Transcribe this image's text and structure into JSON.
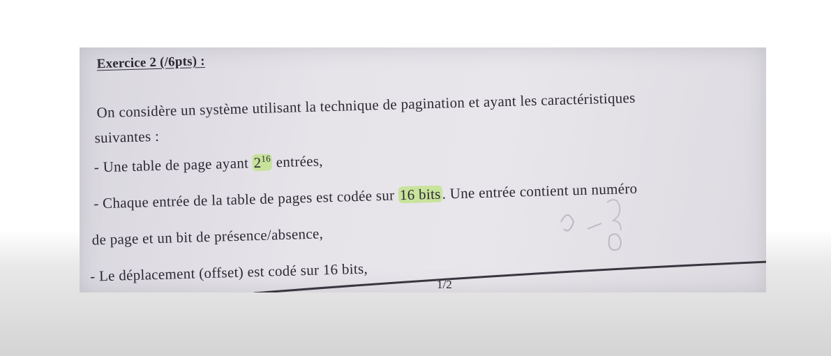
{
  "exercise": {
    "title": "Exercice 2 (/6pts) :",
    "intro_line1": "On considère un système utilisant la technique de pagination et ayant les caractéristiques",
    "intro_line2": "suivantes :",
    "bullet1": {
      "before": "- Une table de page ayant ",
      "base": "2",
      "exponent": "16",
      "after": " entrées,"
    },
    "bullet2": {
      "before": "- Chaque entrée de la table de pages est codée sur ",
      "highlight": "16 bits",
      "after": ". Une entrée contient un numéro"
    },
    "bullet2_cont": "de page et un bit de présence/absence,",
    "bullet3": "- Le déplacement (offset) est codé sur 16 bits,"
  },
  "footer": {
    "page_number": "1/2"
  },
  "colors": {
    "highlight": "#bee182",
    "ink": "#2b2833",
    "paper": "#e4e2e8"
  }
}
